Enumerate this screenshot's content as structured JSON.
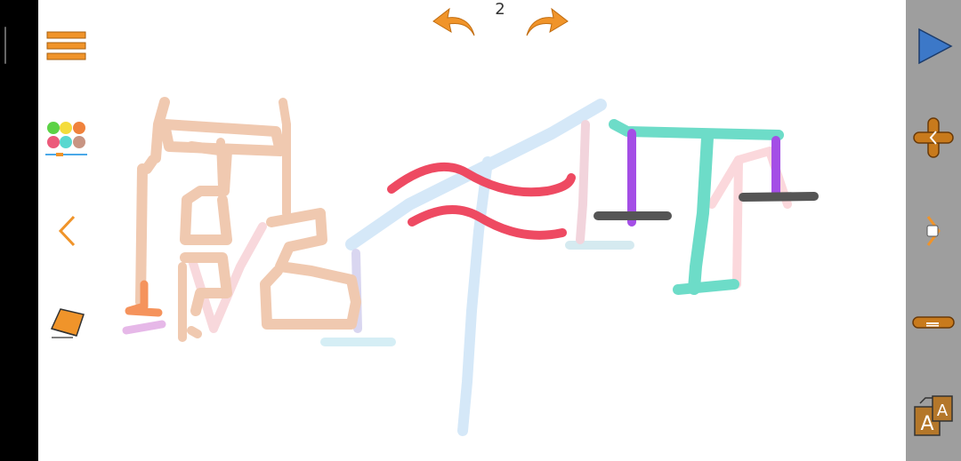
{
  "header": {
    "page_number": "2"
  },
  "left_toolbar": {
    "menu": "menu-icon",
    "palette": "color-palette-icon",
    "back": "chevron-left-icon",
    "eraser": "eraser-icon"
  },
  "right_toolbar": {
    "play": "play-icon",
    "add": "plus-icon",
    "nav": "chevron-right-icon",
    "minus": "minus-icon",
    "font": "font-size-icon"
  },
  "colors": {
    "accent_orange": "#f0942a",
    "play_blue": "#3c78c8",
    "right_bar_bg": "#9e9e9e"
  }
}
